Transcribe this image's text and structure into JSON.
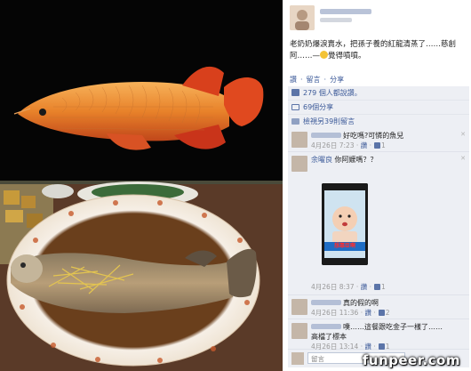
{
  "post": {
    "text_line1": "老奶奶爆淚賣水，把孫子養的紅龍清蒸了……慈創",
    "text_line2_a": "阿……—",
    "text_line2_b": "覺得噴噴。",
    "actions": [
      "讚",
      "·",
      "留言",
      "·",
      "分享"
    ]
  },
  "stats": {
    "likes": "279 個人都說讚。",
    "shares": "69個分享",
    "view_comments": "檢視另39則留言"
  },
  "comments": [
    {
      "text": "好吃嗎?可憐的魚兒",
      "time": "4月26日 7:23",
      "action": "讚",
      "likes": "1"
    },
    {
      "name": "余曜良",
      "text": "你阿嬤嗎？？",
      "time": "4月26日 8:37",
      "action": "讚",
      "likes": "1",
      "image_caption": "想靠臣啊"
    },
    {
      "text": "真的假的啊",
      "time": "4月26日 11:36",
      "action": "讚",
      "likes": "2"
    },
    {
      "text_a": "噗……這餐跟吃金子一樣了……",
      "text_b": "高檔了標本",
      "time": "4月26日 13:14",
      "action": "讚",
      "likes": "1"
    }
  ],
  "input": {
    "placeholder": "留言"
  },
  "watermark": "funpeer.com",
  "colors": {
    "fb_link": "#3b5998",
    "panel_bg": "#edeff4"
  }
}
